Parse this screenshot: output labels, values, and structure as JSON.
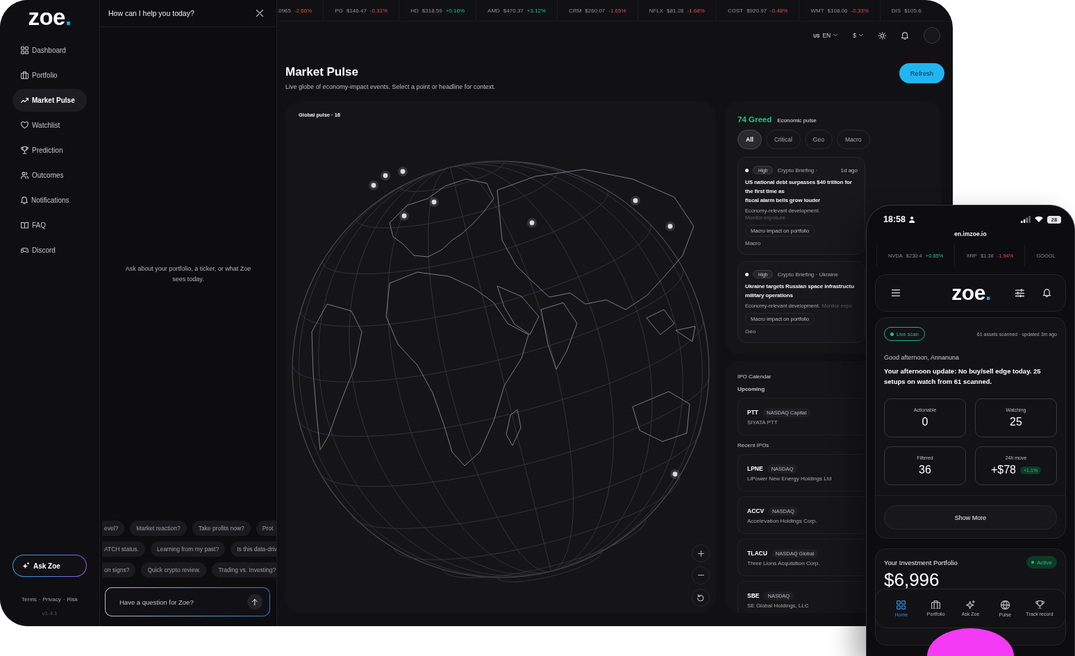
{
  "sidebar": {
    "logo": {
      "text": "zoe",
      "accent": "."
    },
    "nav": [
      {
        "label": "Dashboard",
        "selected": false
      },
      {
        "label": "Portfolio",
        "selected": false
      },
      {
        "label": "Market Pulse",
        "selected": true
      },
      {
        "label": "Watchlist",
        "selected": false
      },
      {
        "label": "Prediction",
        "selected": false
      },
      {
        "label": "Outcomes",
        "selected": false
      },
      {
        "label": "Notifications",
        "selected": false
      },
      {
        "label": "FAQ",
        "selected": false
      },
      {
        "label": "Discord",
        "selected": false
      }
    ],
    "ask_button": "Ask Zoe",
    "footer_links": [
      "Terms",
      "Privacy",
      "Risk"
    ],
    "footer_separator": "·",
    "version": "v1.4.1"
  },
  "chat": {
    "title": "How can I help you today?",
    "empty_message": "Ask about your portfolio, a ticker, or what Zoe sees today.",
    "suggestion_rows": [
      [
        "evel?",
        "Market reaction?",
        "Take profits now?",
        "Prot"
      ],
      [
        "ATCH status.",
        "Learning from my past?",
        "Is this data-driv"
      ],
      [
        "on signs?",
        "Quick crypto review.",
        "Trading vs. Investing?"
      ]
    ],
    "input": {
      "placeholder": "Have a question for Zoe?"
    }
  },
  "main": {
    "ticker": [
      {
        "price": ".0965",
        "change": "-2.66%",
        "rising": false
      },
      {
        "symbol": "PG",
        "price": "$146.47",
        "change": "-0.31%",
        "rising": false
      },
      {
        "symbol": "HD",
        "price": "$318.59",
        "change": "+0.16%",
        "rising": true
      },
      {
        "symbol": "AMD",
        "price": "$470.37",
        "change": "+3.12%",
        "rising": true
      },
      {
        "symbol": "CRM",
        "price": "$260.07",
        "change": "-1.65%",
        "rising": false
      },
      {
        "symbol": "NFLX",
        "price": "$81.28",
        "change": "-1.68%",
        "rising": false
      },
      {
        "symbol": "COST",
        "price": "$920.97",
        "change": "-0.48%",
        "rising": false
      },
      {
        "symbol": "WMT",
        "price": "$108.06",
        "change": "-0.33%",
        "rising": false
      },
      {
        "symbol": "DIS",
        "price": "$105.6"
      }
    ],
    "header": {
      "region": "US",
      "language": "EN",
      "currency": "$"
    },
    "title": "Market Pulse",
    "subtitle": "Live globe of economy-impact events. Select a point or headline for context.",
    "refresh_button": "Refresh",
    "globe": {
      "label": "Global pulse · 16"
    },
    "pulse": {
      "score": "74 Greed",
      "label": "Economic pulse",
      "filters": [
        {
          "label": "All",
          "selected": true
        },
        {
          "label": "Critical",
          "selected": false
        },
        {
          "label": "Geo",
          "selected": false
        },
        {
          "label": "Macro",
          "selected": false
        }
      ],
      "news": [
        {
          "severity": "High",
          "source": "Crypto Briefing ·",
          "time": "1d ago",
          "headline": "US national debt surpasses $40 trillion for the first time as\nfiscal alarm bells grow louder",
          "summary": "Economy-relevant development.",
          "note": "Monitor exposure.",
          "tag": "Macro impact on portfolio",
          "category": "Macro"
        },
        {
          "severity": "High",
          "source": "Crypto Briefing · Ukraine",
          "headline": "Ukraine targets Russian space infrastructu\nmilitary operations",
          "summary": "Economy-relevant development.",
          "note": "Monitor expo",
          "tag": "Macro impact on portfolio",
          "category": "Geo"
        }
      ]
    },
    "ipo": {
      "title": "IPO Calendar",
      "upcoming_label": "Upcoming",
      "upcoming": [
        {
          "ticker": "PTT",
          "exchange": "NASDAQ Capital",
          "name": "SIYATA PTT"
        }
      ],
      "recent_label": "Recent IPOs",
      "recent": [
        {
          "ticker": "LPNE",
          "exchange": "NASDAQ",
          "name": "LiPower New Energy Holdings Ltd"
        },
        {
          "ticker": "ACCV",
          "exchange": "NASDAQ",
          "name": "Accelevation Holdings Corp."
        },
        {
          "ticker": "TLACU",
          "exchange": "NASDAQ Global",
          "name": "Three Lions Acquisition Corp."
        },
        {
          "ticker": "SBE",
          "exchange": "NASDAQ",
          "name": "SE Global Holdings, LLC"
        }
      ]
    }
  },
  "phone": {
    "status_bar": {
      "time": "18:58",
      "battery": "28"
    },
    "url": "en.imzoe.io",
    "ticker": [
      {
        "symbol": "NVDA",
        "price": "$230.4",
        "change": "+0.85%",
        "rising": true
      },
      {
        "symbol": "XRP",
        "price": "$1.38",
        "change": "-1.94%",
        "rising": false
      },
      {
        "symbol": "GOOGL"
      }
    ],
    "logo": {
      "text": "zoe",
      "accent": "."
    },
    "scan": {
      "badge": "Live scan",
      "meta": "61 assets scanned · updated 3m ago",
      "greeting": "Good afternoon, Annanuna",
      "update": "Your afternoon update: No buy/sell edge today. 25 setups on watch from 61 scanned.",
      "stats": [
        {
          "label": "Actionable",
          "value": "0"
        },
        {
          "label": "Watching",
          "value": "25"
        },
        {
          "label": "Filtered",
          "value": "36"
        },
        {
          "label": "24h move",
          "value": "+$78",
          "change": "+1.1%"
        }
      ],
      "button": "Show More"
    },
    "portfolio": {
      "title": "Your Investment Portfolio",
      "status": "Active",
      "value": "$6,996"
    },
    "nav": [
      {
        "label": "Home",
        "selected": true
      },
      {
        "label": "Portfolio",
        "selected": false
      },
      {
        "label": "Ask Zoe",
        "selected": false
      },
      {
        "label": "Pulse",
        "selected": false
      },
      {
        "label": "Track record",
        "selected": false
      }
    ]
  }
}
